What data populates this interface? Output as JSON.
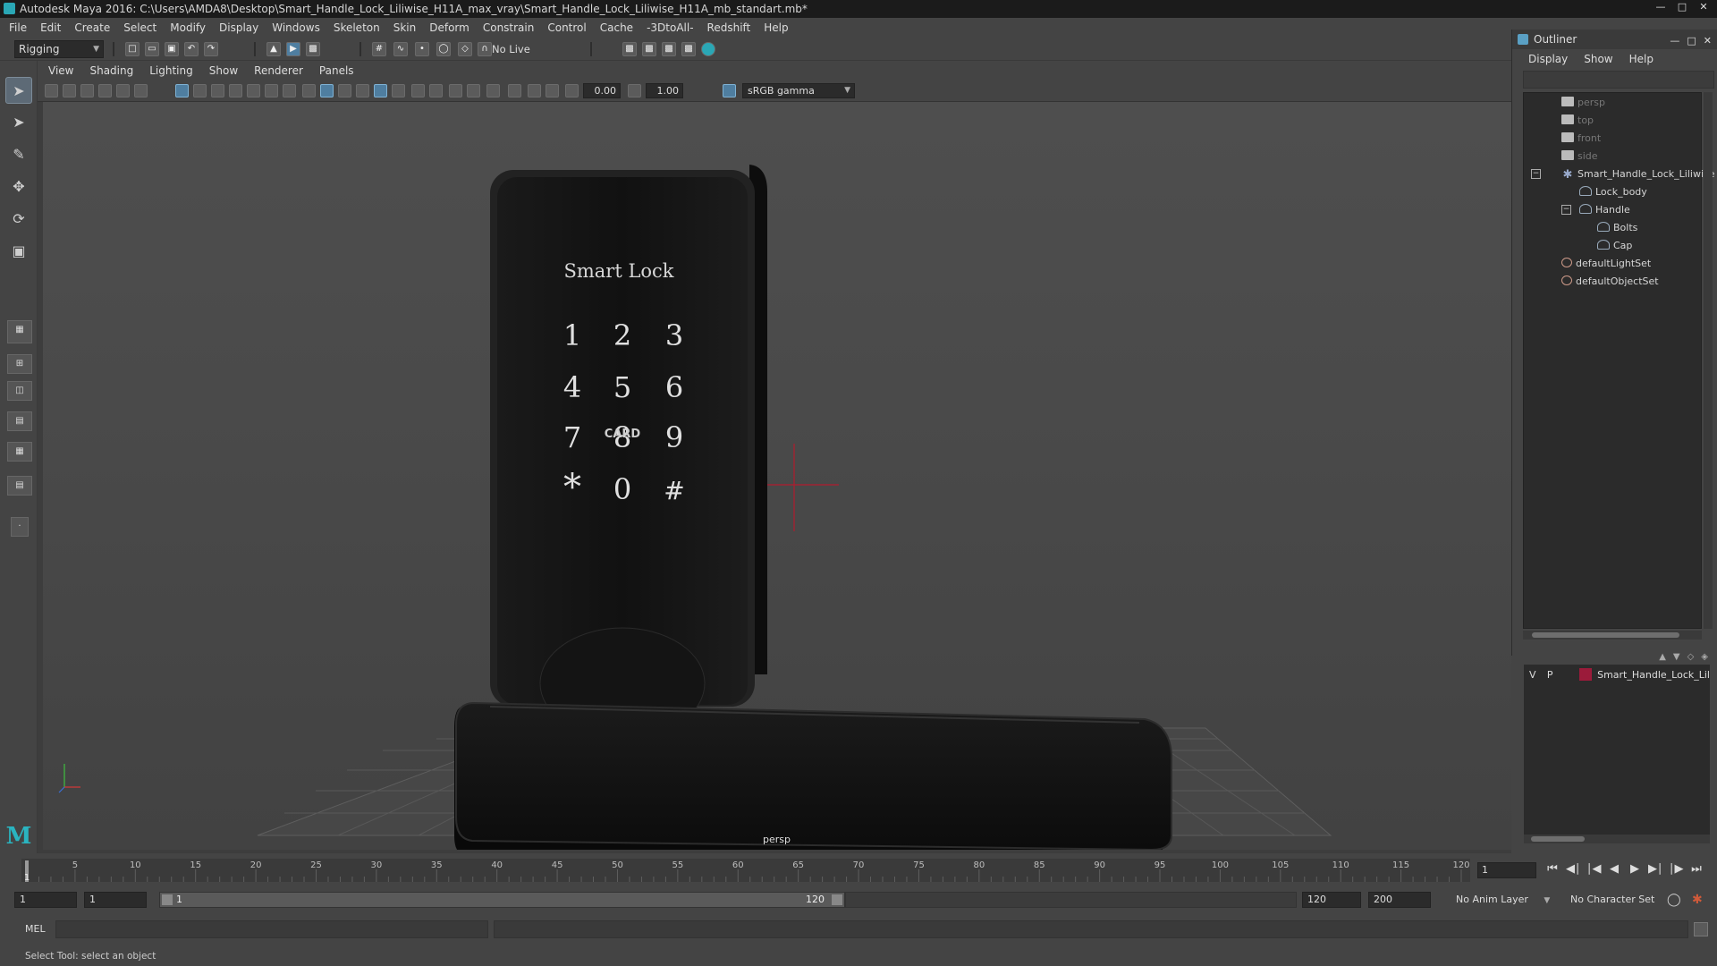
{
  "window": {
    "title": "Autodesk Maya 2016: C:\\Users\\AMDA8\\Desktop\\Smart_Handle_Lock_Liliwise_H11A_max_vray\\Smart_Handle_Lock_Liliwise_H11A_mb_standart.mb*"
  },
  "menus": [
    "File",
    "Edit",
    "Create",
    "Select",
    "Modify",
    "Display",
    "Windows",
    "Skeleton",
    "Skin",
    "Deform",
    "Constrain",
    "Control",
    "Cache",
    "-3DtoAll-",
    "Redshift",
    "Help"
  ],
  "shelf": {
    "mode": "Rigging",
    "live_surface": "No Live Surface"
  },
  "viewport": {
    "menus": [
      "View",
      "Shading",
      "Lighting",
      "Show",
      "Renderer",
      "Panels"
    ],
    "exposure": "0.00",
    "gamma": "1.00",
    "color_space": "sRGB gamma",
    "camera_label": "persp",
    "model": {
      "title": "Smart Lock",
      "keys": [
        "1",
        "2",
        "3",
        "4",
        "5",
        "6",
        "7",
        "8",
        "9",
        "*",
        "0",
        "#"
      ],
      "card_label": "CARD"
    }
  },
  "outliner": {
    "title": "Outliner",
    "menus": [
      "Display",
      "Show",
      "Help"
    ],
    "items": [
      {
        "label": "persp",
        "icon": "camera-icon",
        "dim": true
      },
      {
        "label": "top",
        "icon": "camera-icon",
        "dim": true
      },
      {
        "label": "front",
        "icon": "camera-icon",
        "dim": true
      },
      {
        "label": "side",
        "icon": "camera-icon",
        "dim": true
      },
      {
        "label": "Smart_Handle_Lock_Liliwise",
        "icon": "joint-icon",
        "dim": false
      },
      {
        "label": "Lock_body",
        "icon": "mesh-icon",
        "dim": false
      },
      {
        "label": "Handle",
        "icon": "mesh-icon",
        "dim": false
      },
      {
        "label": "Bolts",
        "icon": "mesh-icon",
        "dim": false
      },
      {
        "label": "Cap",
        "icon": "mesh-icon",
        "dim": false
      },
      {
        "label": "defaultLightSet",
        "icon": "set-icon",
        "dim": false
      },
      {
        "label": "defaultObjectSet",
        "icon": "set-icon",
        "dim": false
      }
    ]
  },
  "layers": {
    "row": {
      "visible": "V",
      "playback": "P",
      "name": "Smart_Handle_Lock_Lil",
      "color": "#9b1b3a"
    }
  },
  "timeline": {
    "ticks": [
      5,
      10,
      15,
      20,
      25,
      30,
      35,
      40,
      45,
      50,
      55,
      60,
      65,
      70,
      75,
      80,
      85,
      90,
      95,
      100,
      105,
      110,
      115,
      120
    ],
    "min": 1,
    "max": 120,
    "current_frame": "1"
  },
  "range": {
    "start_field": "1",
    "start_inner": "1",
    "bar_start": "1",
    "bar_end": "120",
    "end_field": "120",
    "total_end": "200",
    "anim_layer": "No Anim Layer",
    "character_set": "No Character Set"
  },
  "cmd": {
    "label": "MEL"
  },
  "help_line": "Select Tool: select an object",
  "colors": {
    "accent": "#2ab4c0",
    "selected_tool": "#5d6a76",
    "layer_color": "#9b1b3a"
  }
}
